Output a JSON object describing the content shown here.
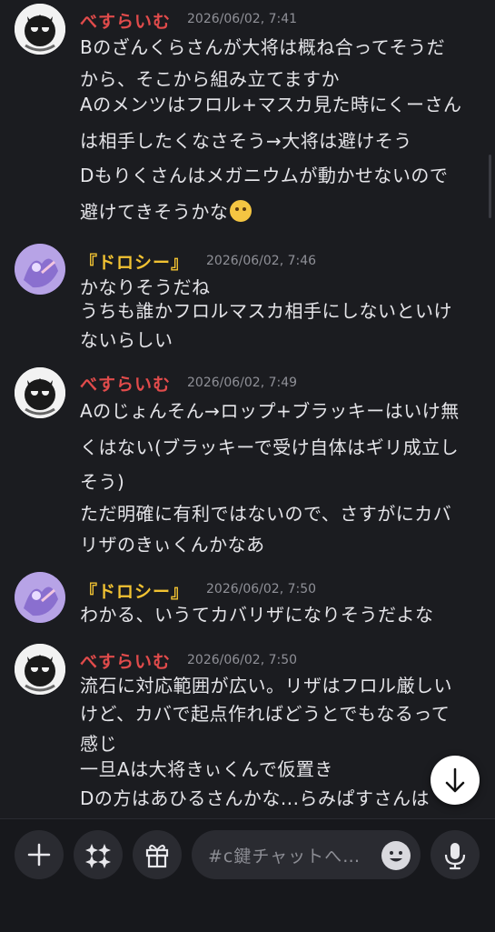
{
  "messages": [
    {
      "author": "べすらいむ",
      "time": "2026/06/02, 7:41",
      "lines": [
        "Bのざんくらさんが大将は概ね合ってそうだ",
        "から、そこから組み立てますか",
        "Aのメンツはフロル+マスカ見た時にくーさん",
        "は相手したくなさそう→大将は避けそう",
        "Dもりくさんはメガニウムが動かせないので",
        "避けてきそうかな"
      ]
    },
    {
      "author": "『ドロシー』",
      "time": "2026/06/02, 7:46",
      "lines": [
        "かなりそうだね",
        "うちも誰かフロルマスカ相手にしないといけ",
        "ないらしい"
      ]
    },
    {
      "author": "べすらいむ",
      "time": "2026/06/02, 7:49",
      "lines": [
        "Aのじょんそん→ロップ+ブラッキーはいけ無",
        "くはない(ブラッキーで受け自体はギリ成立し",
        "そう)",
        "ただ明確に有利ではないので、さすがにカバ",
        "リザのきぃくんかなあ"
      ]
    },
    {
      "author": "『ドロシー』",
      "time": "2026/06/02, 7:50",
      "lines": [
        "わかる、いうてカバリザになりそうだよな"
      ]
    },
    {
      "author": "べすらいむ",
      "time": "2026/06/02, 7:50",
      "lines": [
        "流石に対応範囲が広い。リザはフロル厳しい",
        "けど、カバで起点作ればどうとでもなるって",
        "感じ",
        "一旦Aは大将きぃくんで仮置き",
        "Dの方はあひるさんかな...らみぱすさんは"
      ]
    }
  ],
  "composer": {
    "placeholder": "#c鍵チャットへ…"
  },
  "colors": {
    "author_red": "#e14b4b",
    "author_yellow": "#f1c232",
    "background": "#1b1c20"
  },
  "icons": [
    "plus-icon",
    "sparkle-apps-icon",
    "gift-icon",
    "emoji-icon",
    "microphone-icon",
    "arrow-down-icon",
    "thinking-face-emoji"
  ]
}
